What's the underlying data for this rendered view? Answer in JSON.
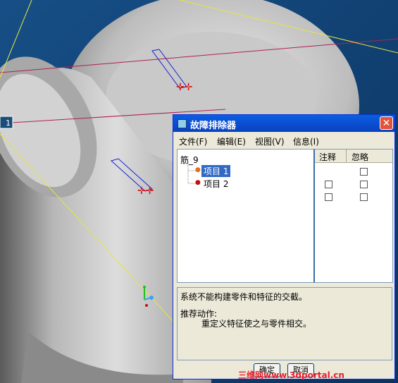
{
  "window": {
    "title": "故障排除器",
    "close_glyph": "✕"
  },
  "menu": {
    "file": "文件(F)",
    "edit": "编辑(E)",
    "view": "视图(V)",
    "info": "信息(I)"
  },
  "tree": {
    "root": "筋_9",
    "items": [
      {
        "label": "项目 1",
        "selected": true
      },
      {
        "label": "项目 2",
        "selected": false
      }
    ]
  },
  "columns": {
    "note": "注释",
    "ignore": "忽略"
  },
  "message": {
    "line1": "系统不能构建零件和特征的交截。",
    "line2": "推荐动作:",
    "line3": "重定义特征使之与零件相交。"
  },
  "buttons": {
    "ok": "确定",
    "cancel": "取消"
  },
  "watermark": "三维网www.3dportal.cn",
  "viewport_label": "1",
  "colors": {
    "accent": "#0b4ccf",
    "bg_model": "#1a4d7a"
  }
}
